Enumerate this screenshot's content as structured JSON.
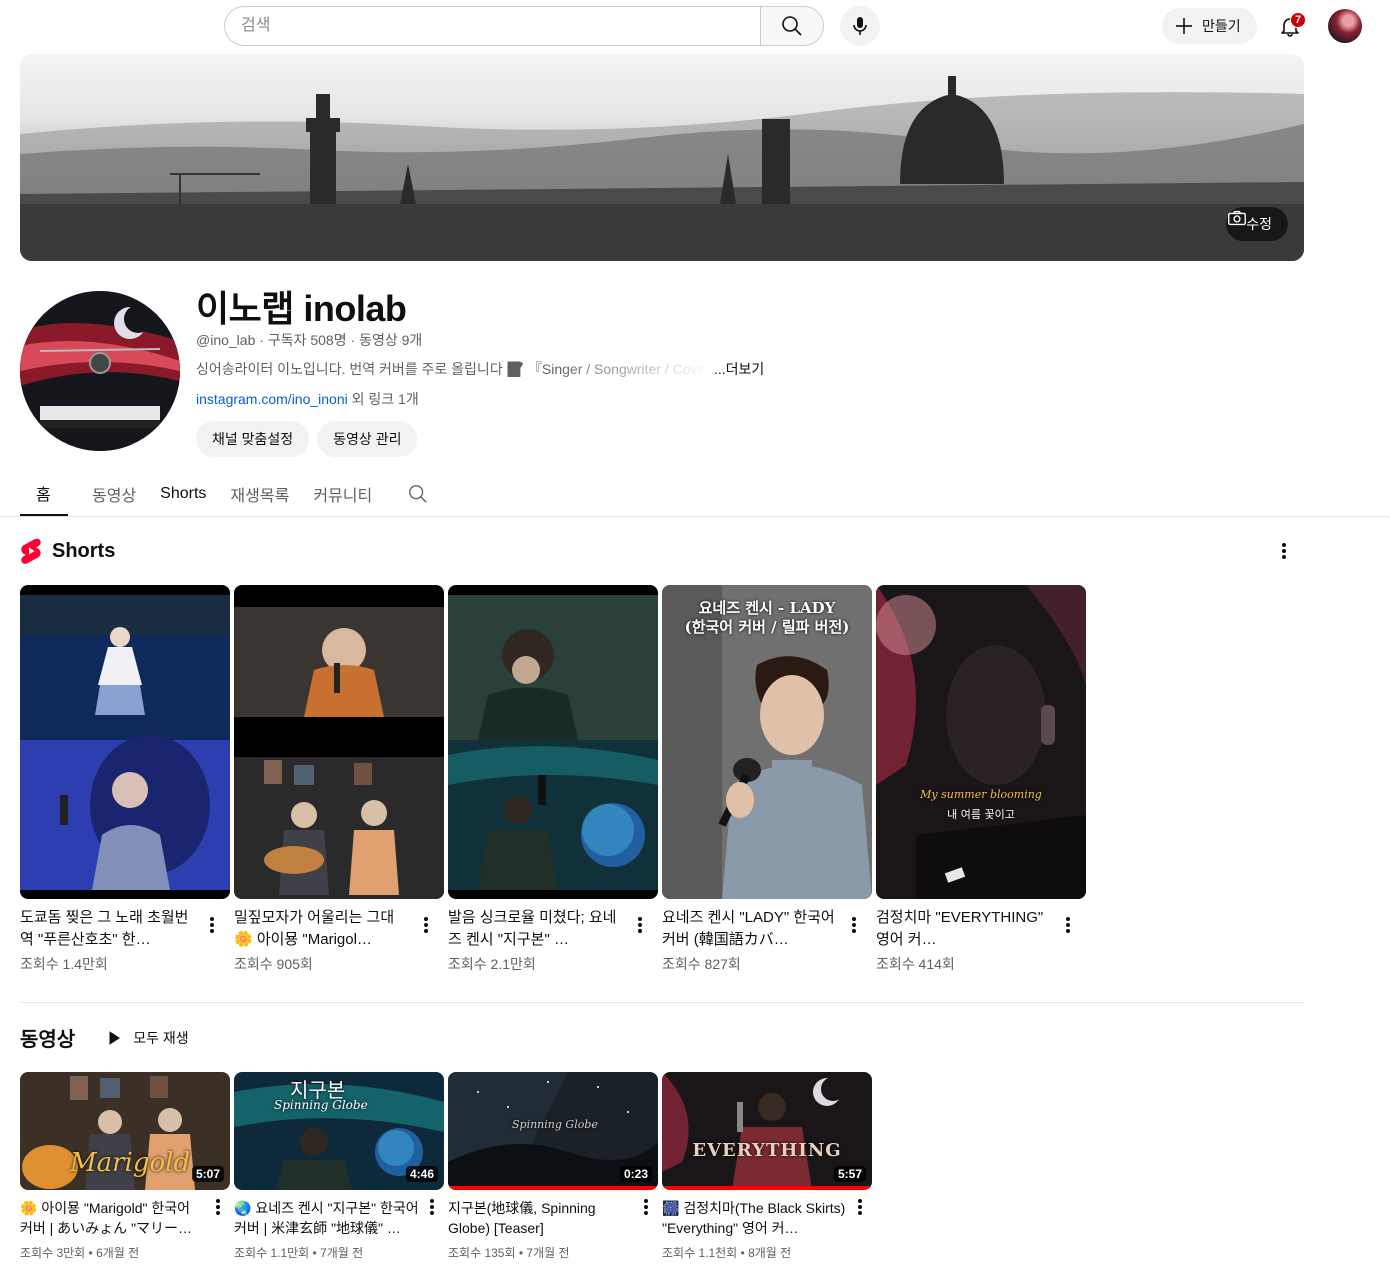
{
  "topbar": {
    "search_placeholder": "검색",
    "create_label": "만들기",
    "notification_count": "7"
  },
  "banner": {
    "edit_label": "수정"
  },
  "channel": {
    "title": "이노랩 inolab",
    "handle": "@ino_lab",
    "subscribers": "구독자 508명",
    "video_count": "동영상 9개",
    "description": "싱어송라이터 이노입니다. 번역 커버를 주로 올립니다 📝 『Singer / Songwriter / Cover",
    "more_label": "...더보기",
    "link_text": "instagram.com/ino_inoni",
    "link_extra": " 외 링크 1개",
    "customize_label": "채널 맞춤설정",
    "manage_label": "동영상 관리"
  },
  "tabs": [
    {
      "label": "홈"
    },
    {
      "label": "동영상"
    },
    {
      "label": "Shorts"
    },
    {
      "label": "재생목록"
    },
    {
      "label": "커뮤니티"
    }
  ],
  "shorts_section": {
    "title": "Shorts",
    "items": [
      {
        "title": "도쿄돔 찢은 그 노래 초월번역 \"푸른산호초\" 한…",
        "views": "조회수 1.4만회"
      },
      {
        "title": "밀짚모자가 어울리는 그대 🌼 아이묭 \"Marigol…",
        "views": "조회수 905회"
      },
      {
        "title": "발음 싱크로율 미쳤다; 요네즈 켄시 \"지구본\" …",
        "views": "조회수 2.1만회"
      },
      {
        "title": "요네즈 켄시 \"LADY\" 한국어 커버 (韓国語カバ…",
        "views": "조회수 827회"
      },
      {
        "title": "검정치마 \"EVERYTHING\" 영어 커…",
        "views": "조회수 414회"
      }
    ],
    "thumb_texts": {
      "lady_line1": "요네즈 켄시 - LADY",
      "lady_line2": "(한국어 커버 / 릴파 버전)",
      "everything_line1": "My summer blooming",
      "everything_line2": "내 여름 꽃이고"
    }
  },
  "videos_section": {
    "title": "동영상",
    "play_all_label": "모두 재생",
    "items": [
      {
        "title": "🌼 아이묭 \"Marigold\" 한국어 커버 | あいみょん \"マリーゴ…",
        "views": "조회수 3만회",
        "age": "6개월 전",
        "duration": "5:07",
        "progress": 0.0,
        "thumb_text": "Marigold"
      },
      {
        "title": "🌏 요네즈 켄시 \"지구본\" 한국어 커버 | 米津玄師 \"地球儀\" …",
        "views": "조회수 1.1만회",
        "age": "7개월 전",
        "duration": "4:46",
        "progress": 0.0,
        "thumb_text_1": "지구본",
        "thumb_text_2": "Spinning Globe"
      },
      {
        "title": "지구본(地球儀, Spinning Globe) [Teaser]",
        "views": "조회수 135회",
        "age": "7개월 전",
        "duration": "0:23",
        "progress": 1.0,
        "thumb_text": "Spinning Globe"
      },
      {
        "title": "🎆 검정치마(The Black Skirts) \"Everything\" 영어 커…",
        "views": "조회수 1.1천회",
        "age": "8개월 전",
        "duration": "5:57",
        "progress": 1.0,
        "thumb_text": "EVERYTHING"
      }
    ]
  },
  "separator": " • ",
  "meta_separator": " · "
}
